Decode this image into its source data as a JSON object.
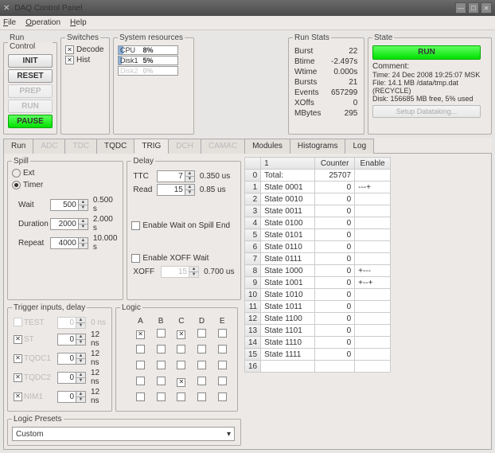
{
  "window": {
    "title": "DAQ Control Panel"
  },
  "menu": {
    "file": "File",
    "operation": "Operation",
    "help": "Help"
  },
  "runcontrol": {
    "legend": "Run Control",
    "init": "INIT",
    "reset": "RESET",
    "prep": "PREP",
    "run": "RUN",
    "pause": "PAUSE"
  },
  "switches": {
    "legend": "Switches",
    "decode": "Decode",
    "hist": "Hist"
  },
  "sysres": {
    "legend": "System resources",
    "cpu_label": "CPU",
    "cpu_pct": "8%",
    "disk1_label": "Disk1",
    "disk1_pct": "5%",
    "disk2_label": "Disk2",
    "disk2_pct": "0%"
  },
  "runstats": {
    "legend": "Run Stats",
    "burst": "Burst",
    "burst_v": "22",
    "btime": "Btime",
    "btime_v": "-2.497s",
    "wtime": "Wtime",
    "wtime_v": "0.000s",
    "bursts": "Bursts",
    "bursts_v": "21",
    "events": "Events",
    "events_v": "657299",
    "xoffs": "XOffs",
    "xoffs_v": "0",
    "mbytes": "MBytes",
    "mbytes_v": "295"
  },
  "state": {
    "legend": "State",
    "run": "RUN",
    "comment": "Comment:",
    "time": "Time: 24 Dec 2008 19:25:07 MSK",
    "file": "File: 14.1 MB /data/tmp.dat (RECYCLE)",
    "disk": "Disk: 156685 MB free,  5% used",
    "setup": "Setup Datataking..."
  },
  "tabs": {
    "run": "Run",
    "adc": "ADC",
    "tdc": "TDC",
    "tqdc": "TQDC",
    "trig": "TRIG",
    "dch": "DCH",
    "camac": "CAMAC",
    "modules": "Modules",
    "histograms": "Histograms",
    "log": "Log"
  },
  "spill": {
    "legend": "Spill",
    "ext": "Ext",
    "timer": "Timer",
    "wait": "Wait",
    "wait_v": "500",
    "wait_u": "0.500 s",
    "duration": "Duration",
    "duration_v": "2000",
    "duration_u": "2.000 s",
    "repeat": "Repeat",
    "repeat_v": "4000",
    "repeat_u": "10.000 s"
  },
  "delay": {
    "legend": "Delay",
    "ttc": "TTC",
    "ttc_v": "7",
    "ttc_u": "0.350 us",
    "read": "Read",
    "read_v": "15",
    "read_u": "0.85 us",
    "wait_spill": "Enable Wait on Spill End",
    "xoff_wait": "Enable XOFF Wait",
    "xoff": "XOFF",
    "xoff_v": "15",
    "xoff_u": "0.700 us"
  },
  "triginputs": {
    "legend": "Trigger inputs, delay",
    "rows": [
      {
        "name": "TEST",
        "enabled": false,
        "val": "0",
        "unit": "0 ns",
        "dis": true
      },
      {
        "name": "ST",
        "enabled": true,
        "val": "0",
        "unit": "12 ns",
        "dis_name": true
      },
      {
        "name": "TQDC1",
        "enabled": true,
        "val": "0",
        "unit": "12 ns",
        "dis_name": true
      },
      {
        "name": "TQDC2",
        "enabled": true,
        "val": "0",
        "unit": "12 ns",
        "dis_name": true
      },
      {
        "name": "NIM1",
        "enabled": true,
        "val": "0",
        "unit": "12 ns",
        "dis_name": true
      }
    ]
  },
  "logic": {
    "legend": "Logic",
    "cols": [
      "A",
      "B",
      "C",
      "D",
      "E"
    ],
    "grid": [
      [
        true,
        false,
        true,
        false,
        false
      ],
      [
        false,
        false,
        false,
        false,
        false
      ],
      [
        false,
        false,
        false,
        false,
        false
      ],
      [
        false,
        false,
        true,
        false,
        false
      ],
      [
        false,
        false,
        false,
        false,
        false
      ]
    ]
  },
  "presets": {
    "legend": "Logic Presets",
    "value": "Custom"
  },
  "countertable": {
    "h1": "1",
    "h2": "Counter",
    "h3": "Enable",
    "rows": [
      {
        "i": "0",
        "n": "Total:",
        "c": "25707",
        "e": ""
      },
      {
        "i": "1",
        "n": "State 0001",
        "c": "0",
        "e": "---+"
      },
      {
        "i": "2",
        "n": "State 0010",
        "c": "0",
        "e": ""
      },
      {
        "i": "3",
        "n": "State 0011",
        "c": "0",
        "e": ""
      },
      {
        "i": "4",
        "n": "State 0100",
        "c": "0",
        "e": ""
      },
      {
        "i": "5",
        "n": "State 0101",
        "c": "0",
        "e": ""
      },
      {
        "i": "6",
        "n": "State 0110",
        "c": "0",
        "e": ""
      },
      {
        "i": "7",
        "n": "State 0111",
        "c": "0",
        "e": ""
      },
      {
        "i": "8",
        "n": "State 1000",
        "c": "0",
        "e": "+---"
      },
      {
        "i": "9",
        "n": "State 1001",
        "c": "0",
        "e": "+--+"
      },
      {
        "i": "10",
        "n": "State 1010",
        "c": "0",
        "e": ""
      },
      {
        "i": "11",
        "n": "State 1011",
        "c": "0",
        "e": ""
      },
      {
        "i": "12",
        "n": "State 1100",
        "c": "0",
        "e": ""
      },
      {
        "i": "13",
        "n": "State 1101",
        "c": "0",
        "e": ""
      },
      {
        "i": "14",
        "n": "State 1110",
        "c": "0",
        "e": ""
      },
      {
        "i": "15",
        "n": "State 1111",
        "c": "0",
        "e": ""
      },
      {
        "i": "16",
        "n": "",
        "c": "",
        "e": ""
      }
    ]
  }
}
